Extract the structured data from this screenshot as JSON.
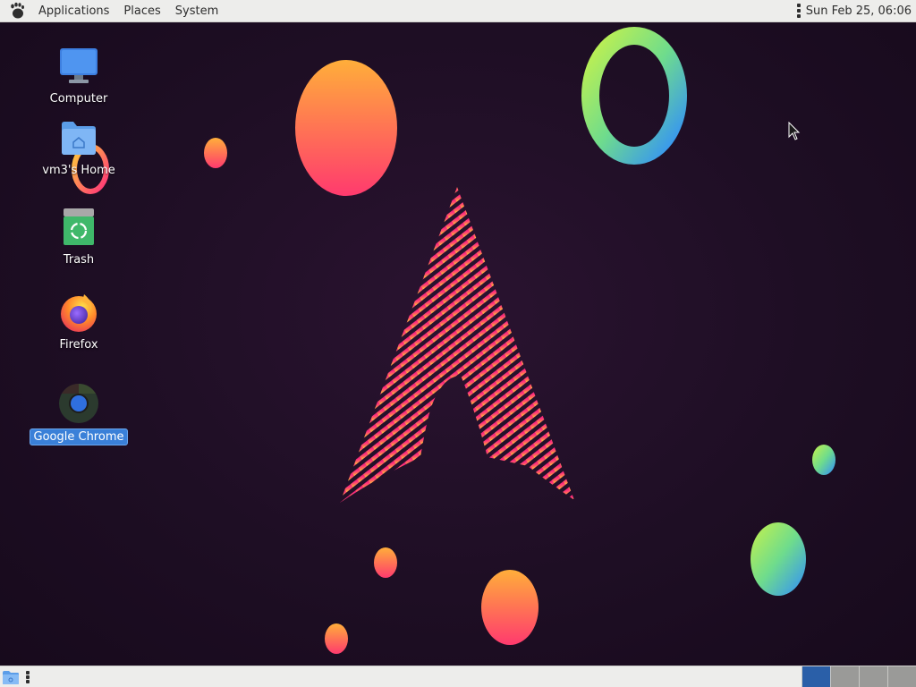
{
  "top_panel": {
    "menus": [
      {
        "label": "Applications"
      },
      {
        "label": "Places"
      },
      {
        "label": "System"
      }
    ],
    "clock": "Sun Feb 25, 06:06"
  },
  "desktop": {
    "icons": [
      {
        "label": "Computer",
        "icon": "computer-icon",
        "selected": false
      },
      {
        "label": "vm3's Home",
        "icon": "home-folder-icon",
        "selected": false
      },
      {
        "label": "Trash",
        "icon": "trash-icon",
        "selected": false
      },
      {
        "label": "Firefox",
        "icon": "firefox-icon",
        "selected": false
      },
      {
        "label": "Google Chrome",
        "icon": "chrome-icon",
        "selected": true
      }
    ]
  },
  "bottom_panel": {
    "workspaces": 4,
    "active_workspace": 1
  },
  "colors": {
    "panel_bg": "#ededeb",
    "desktop_bg": "#1f0f26",
    "selection": "#3a80d8",
    "active_workspace": "#2a5fa8"
  }
}
